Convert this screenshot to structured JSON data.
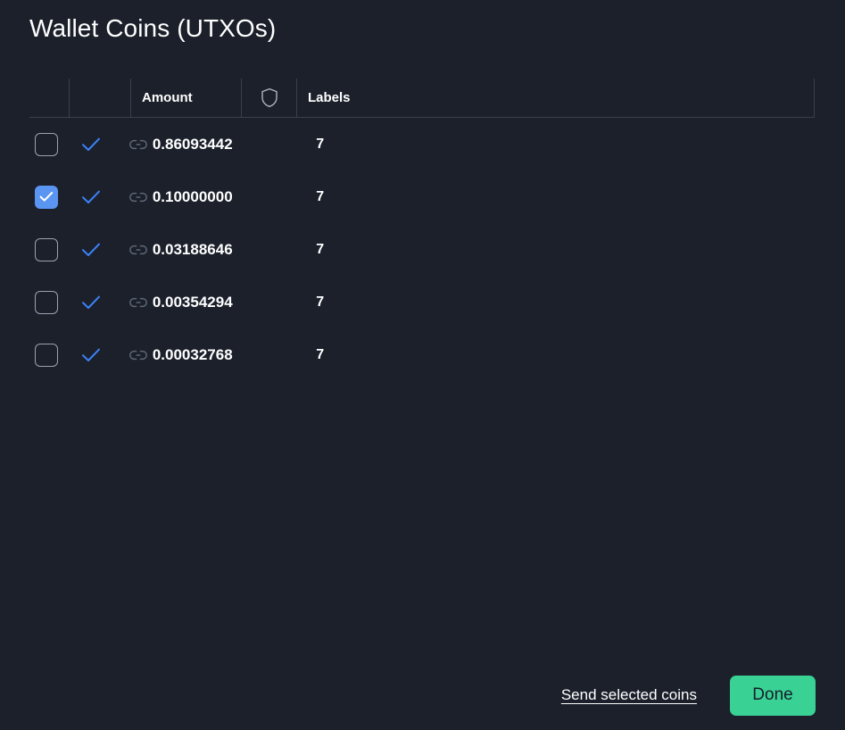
{
  "window": {
    "title": "Wallet Coins (UTXOs)",
    "background_color": "#1b202b"
  },
  "table": {
    "columns": [
      {
        "key": "select",
        "label": "",
        "icon": "checkbox-column"
      },
      {
        "key": "status",
        "label": "",
        "icon": "confirmation-column"
      },
      {
        "key": "amount",
        "label": "Amount",
        "icon": ""
      },
      {
        "key": "privacy",
        "label": "",
        "icon": "shield-icon"
      },
      {
        "key": "labels",
        "label": "Labels",
        "icon": ""
      }
    ],
    "rows": [
      {
        "selected": false,
        "confirmed": true,
        "link": true,
        "amount": "0.86093442",
        "privacy": "7",
        "labels": ""
      },
      {
        "selected": true,
        "confirmed": true,
        "link": true,
        "amount": "0.10000000",
        "privacy": "7",
        "labels": ""
      },
      {
        "selected": false,
        "confirmed": true,
        "link": true,
        "amount": "0.03188646",
        "privacy": "7",
        "labels": ""
      },
      {
        "selected": false,
        "confirmed": true,
        "link": true,
        "amount": "0.00354294",
        "privacy": "7",
        "labels": ""
      },
      {
        "selected": false,
        "confirmed": true,
        "link": true,
        "amount": "0.00032768",
        "privacy": "7",
        "labels": ""
      }
    ]
  },
  "footer": {
    "send_label": "Send selected coins",
    "done_label": "Done",
    "done_color": "#3ad195"
  },
  "colors": {
    "accent_blue": "#5b95f2",
    "check_blue": "#3b82f6",
    "link_gray": "#5f6775",
    "border": "#39404e",
    "text": "#ffffff"
  }
}
